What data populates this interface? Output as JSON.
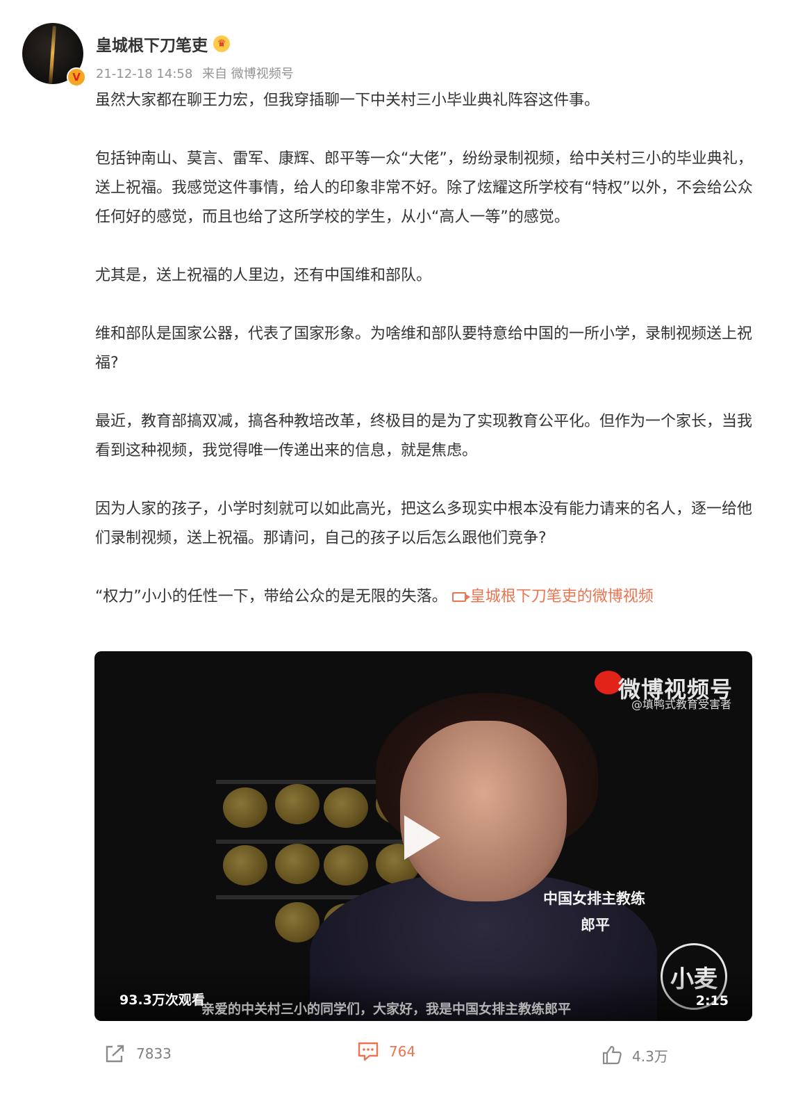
{
  "post": {
    "author": "皇城根下刀笔吏",
    "verified_badge": "V",
    "crown_icon": "crown-icon",
    "timestamp": "21-12-18 14:58",
    "source": "来自 微博视频号",
    "paragraphs": [
      "虽然大家都在聊王力宏，但我穿插聊一下中关村三小毕业典礼阵容这件事。",
      "包括钟南山、莫言、雷军、康辉、郎平等一众“大佬”，纷纷录制视频，给中关村三小的毕业典礼，送上祝福。我感觉这件事情，给人的印象非常不好。除了炫耀这所学校有“特权”以外，不会给公众任何好的感觉，而且也给了这所学校的学生，从小“高人一等”的感觉。",
      "尤其是，送上祝福的人里边，还有中国维和部队。",
      "维和部队是国家公器，代表了国家形象。为啥维和部队要特意给中国的一所小学，录制视频送上祝福?",
      "最近，教育部搞双减，搞各种教培改革，终极目的是为了实现教育公平化。但作为一个家长，当我看到这种视频，我觉得唯一传递出来的信息，就是焦虑。",
      "因为人家的孩子，小学时刻就可以如此高光，把这么多现实中根本没有能力请来的名人，逐一给他们录制视频，送上祝福。那请问，自己的孩子以后怎么跟他们竞争?"
    ],
    "last_paragraph": "“权力”小小的任性一下，带给公众的是无限的失落。",
    "video_link": "皇城根下刀笔吏的微博视频",
    "link_color": "#eb7350"
  },
  "video": {
    "watermark_main": "微博视频号",
    "watermark_sub": "@填鸭式教育受害者",
    "caption_role": "中国女排主教练",
    "caption_name": "郎平",
    "logo_text": "小麦",
    "subtitle": "亲爱的中关村三小的同学们，大家好，我是中国女排主教练郎平",
    "views": "93.3万次观看",
    "duration": "2:15"
  },
  "actions": {
    "repost_count": "7833",
    "comment_count": "764",
    "like_count": "4.3万"
  }
}
